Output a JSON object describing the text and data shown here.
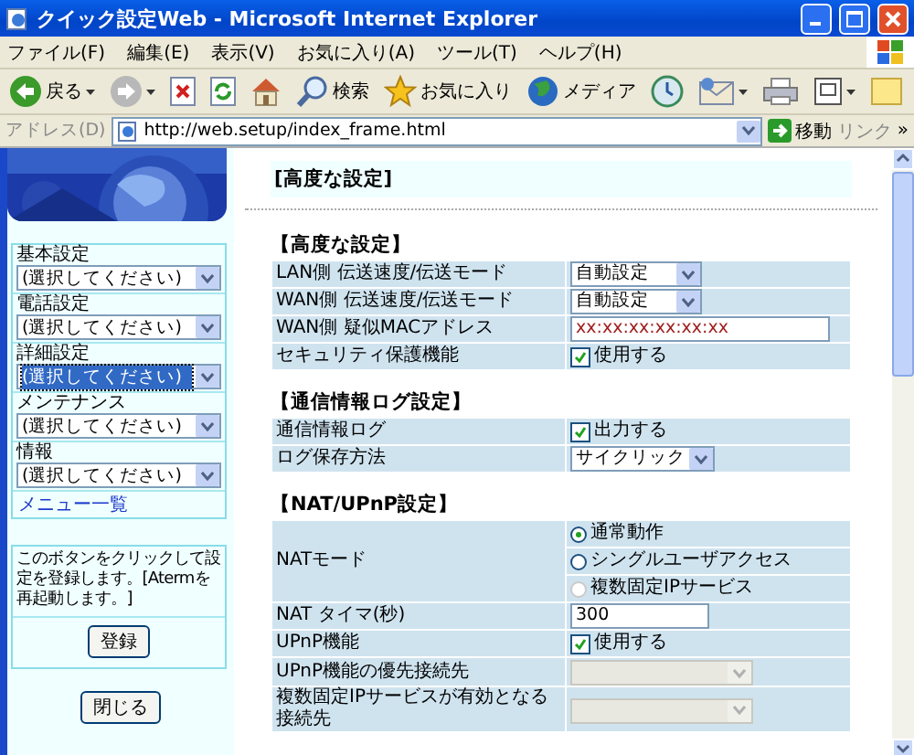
{
  "window": {
    "title": "クイック設定Web - Microsoft Internet Explorer"
  },
  "menu": [
    "ファイル(F)",
    "編集(E)",
    "表示(V)",
    "お気に入り(A)",
    "ツール(T)",
    "ヘルプ(H)"
  ],
  "toolbar": [
    {
      "kind": "back",
      "label": "戻る"
    },
    {
      "kind": "forward"
    },
    {
      "kind": "stop"
    },
    {
      "kind": "refresh"
    },
    {
      "kind": "home"
    },
    {
      "kind": "search",
      "label": "検索"
    },
    {
      "kind": "favorites",
      "label": "お気に入り"
    },
    {
      "kind": "media",
      "label": "メディア"
    },
    {
      "kind": "history"
    },
    {
      "kind": "mail"
    },
    {
      "kind": "print"
    },
    {
      "kind": "edit"
    },
    {
      "kind": "notes"
    }
  ],
  "address": {
    "label": "アドレス(D)",
    "url": "http://web.setup/index_frame.html",
    "go": "移動",
    "links": "リンク",
    "more": "»"
  },
  "sidebar": {
    "groups": [
      {
        "label": "基本設定",
        "value": "(選択してください)",
        "focused": false
      },
      {
        "label": "電話設定",
        "value": "(選択してください)",
        "focused": false
      },
      {
        "label": "詳細設定",
        "value": "(選択してください)",
        "focused": true
      },
      {
        "label": "メンテナンス",
        "value": "(選択してください)",
        "focused": false
      },
      {
        "label": "情報",
        "value": "(選択してください)",
        "focused": false
      }
    ],
    "menu_link": "メニュー一覧",
    "note": "このボタンをクリックして設定を登録します。[Atermを再起動します。]",
    "register_button": "登録",
    "close_button": "閉じる"
  },
  "main": {
    "header": "[高度な設定]",
    "sections": [
      {
        "title": "【高度な設定】",
        "rows": [
          {
            "label": "LAN側 伝送速度/伝送モード",
            "kind": "select",
            "value": "自動設定",
            "disabled": false
          },
          {
            "label": "WAN側 伝送速度/伝送モード",
            "kind": "select",
            "value": "自動設定",
            "disabled": false
          },
          {
            "label": "WAN側 疑似MACアドレス",
            "kind": "text",
            "value": "xx:xx:xx:xx:xx:xx"
          },
          {
            "label": "セキュリティ保護機能",
            "kind": "checkbox",
            "text": "使用する",
            "checked": true
          }
        ]
      },
      {
        "title": "【通信情報ログ設定】",
        "rows": [
          {
            "label": "通信情報ログ",
            "kind": "checkbox",
            "text": "出力する",
            "checked": true
          },
          {
            "label": "ログ保存方法",
            "kind": "select",
            "value": "サイクリック",
            "disabled": false
          }
        ]
      },
      {
        "title": "【NAT/UPnP設定】",
        "rows": [
          {
            "label": "NATモード",
            "kind": "radio",
            "options": [
              {
                "label": "通常動作",
                "selected": true,
                "disabled": false
              },
              {
                "label": "シングルユーザアクセス",
                "selected": false,
                "disabled": false
              },
              {
                "label": "複数固定IPサービス",
                "selected": false,
                "disabled": true
              }
            ]
          },
          {
            "label": "NAT タイマ(秒)",
            "kind": "text",
            "value": "300"
          },
          {
            "label": "UPnP機能",
            "kind": "checkbox",
            "text": "使用する",
            "checked": true
          },
          {
            "label": "UPnP機能の優先接続先",
            "kind": "select",
            "disabled": true
          },
          {
            "label": "複数固定IPサービスが有効となる接続先",
            "kind": "select",
            "disabled": true
          }
        ]
      }
    ]
  }
}
